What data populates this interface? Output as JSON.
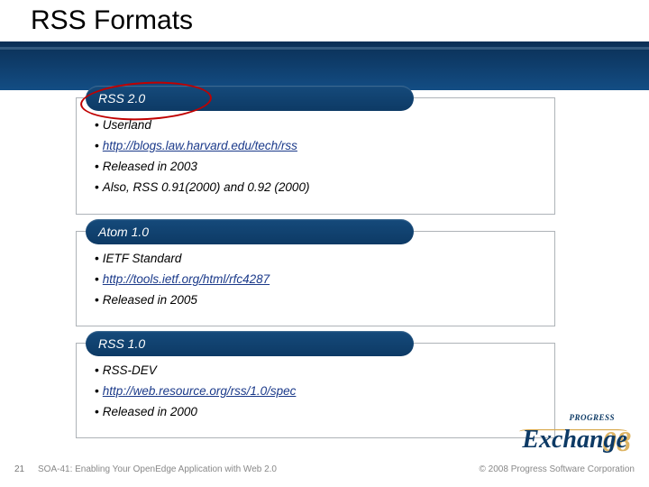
{
  "title": "RSS Formats",
  "panels": [
    {
      "heading": "RSS 2.0",
      "ring": true,
      "items": [
        {
          "text": "Userland"
        },
        {
          "text": "http://blogs.law.harvard.edu/tech/rss",
          "link": true
        },
        {
          "text": "Released in 2003"
        },
        {
          "text": "Also, RSS 0.91(2000) and 0.92 (2000)"
        }
      ]
    },
    {
      "heading": "Atom 1.0",
      "items": [
        {
          "text": "IETF Standard"
        },
        {
          "text": "http://tools.ietf.org/html/rfc4287",
          "link": true
        },
        {
          "text": "Released in 2005"
        }
      ]
    },
    {
      "heading": "RSS 1.0",
      "items": [
        {
          "text": "RSS-DEV"
        },
        {
          "text": "http://web.resource.org/rss/1.0/spec",
          "link": true
        },
        {
          "text": "Released in 2000"
        }
      ]
    }
  ],
  "footer": {
    "page_number": "21",
    "subtitle": "SOA-41: Enabling Your OpenEdge Application with Web 2.0",
    "copyright": "© 2008 Progress Software Corporation"
  },
  "logo": {
    "brand_small": "PROGRESS",
    "brand_word": "Exchange",
    "year_fragment": "08"
  }
}
